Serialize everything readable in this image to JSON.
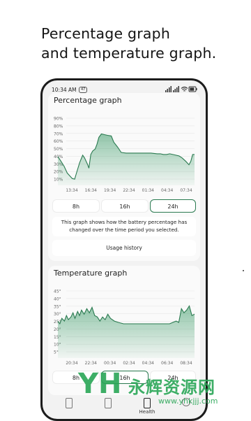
{
  "headline": {
    "line1": "Percentage graph",
    "line2": "and temperature graph."
  },
  "status_bar": {
    "time": "10:34 AM",
    "badge": "47"
  },
  "percentage_card": {
    "title": "Percentage graph",
    "chart_data": {
      "type": "area",
      "y_ticks": [
        "90%",
        "80%",
        "70%",
        "60%",
        "50%",
        "40%",
        "30%",
        "20%",
        "10%"
      ],
      "x_ticks": [
        "13:34",
        "16:34",
        "19:34",
        "22:34",
        "01:34",
        "04:34",
        "07:34"
      ],
      "ylim": [
        0,
        100
      ],
      "x": [
        0,
        0.5,
        1,
        1.5,
        2,
        2.3,
        2.7,
        3.0,
        3.5,
        4,
        4.3,
        4.8,
        5.0,
        5.3,
        5.6,
        6.0,
        6.3,
        6.6,
        7.0,
        7.5,
        8.0,
        8.6,
        9.0,
        9.6,
        10.2,
        11,
        12,
        13,
        14,
        15,
        16,
        16.5,
        17.0,
        17.5,
        18.0,
        18.5,
        19.0,
        19.5,
        20.0,
        20.6,
        21.1,
        21.4,
        21.7,
        22.0
      ],
      "values": [
        42,
        35,
        28,
        18,
        13,
        10,
        9,
        18,
        33,
        44,
        40,
        30,
        25,
        45,
        50,
        53,
        60,
        70,
        75,
        74,
        73,
        72,
        63,
        56,
        48,
        47,
        47,
        47,
        47,
        47,
        46,
        46,
        45,
        45,
        46,
        45,
        44,
        43,
        40,
        35,
        30,
        35,
        45,
        45
      ],
      "grid": true,
      "color": "#2a7a50"
    },
    "ranges": [
      "8h",
      "16h",
      "24h"
    ],
    "active_range": "24h",
    "description": "This graph shows how the battery percentage has changed over the time period you selected.",
    "usage_button": "Usage history"
  },
  "temperature_card": {
    "title": "Temperature graph",
    "chart_data": {
      "type": "area",
      "y_ticks": [
        "45°",
        "40°",
        "35°",
        "30°",
        "25°",
        "20°",
        "15°",
        "10°",
        "5°"
      ],
      "x_ticks": [
        "20:34",
        "22:34",
        "00:34",
        "02:34",
        "04:34",
        "06:34",
        "08:34"
      ],
      "ylim": [
        0,
        50
      ],
      "x": [
        0,
        0.3,
        0.6,
        1.0,
        1.3,
        1.6,
        2.0,
        2.3,
        2.6,
        3.0,
        3.3,
        3.6,
        4.0,
        4.4,
        4.8,
        5.2,
        5.6,
        6.0,
        6.4,
        6.8,
        7.2,
        7.6,
        8.0,
        8.6,
        9.2,
        10.0,
        11.0,
        12.0,
        13.0,
        14.0,
        15.0,
        16.0,
        17.0,
        17.5,
        18.0,
        18.4,
        18.8,
        19.2,
        19.6,
        20.0,
        20.4,
        20.8
      ],
      "values": [
        27,
        25,
        29,
        27,
        31,
        28,
        30,
        33,
        29,
        34,
        31,
        35,
        32,
        36,
        33,
        37,
        31,
        30,
        27,
        30,
        28,
        32,
        29,
        27,
        26,
        25,
        25,
        25,
        25,
        25,
        25,
        25,
        25,
        26,
        27,
        26,
        36,
        33,
        35,
        38,
        31,
        32
      ],
      "grid": true,
      "color": "#2a7a50"
    },
    "ranges": [
      "8h",
      "16h",
      "24h"
    ],
    "active_range": "16h"
  },
  "bottom_nav": {
    "items": [
      {
        "label": "",
        "icon": "battery-icon"
      },
      {
        "label": "",
        "icon": "battery-icon"
      },
      {
        "label": "Health",
        "icon": "battery-health-icon"
      },
      {
        "label": "",
        "icon": "settings-icon"
      }
    ]
  },
  "watermark": {
    "cn": "永辉资源网",
    "url": "www.yhkjjj.com"
  }
}
